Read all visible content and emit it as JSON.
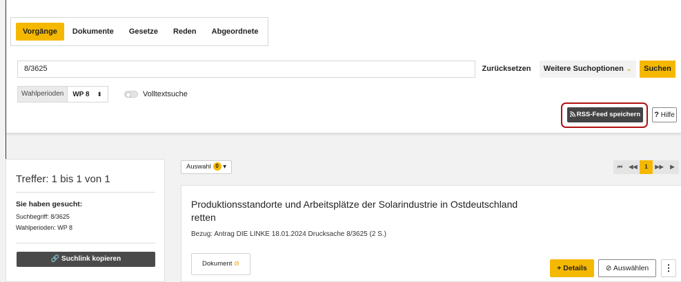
{
  "tabs": [
    {
      "label": "Vorgänge",
      "active": true
    },
    {
      "label": "Dokumente",
      "active": false
    },
    {
      "label": "Gesetze",
      "active": false
    },
    {
      "label": "Reden",
      "active": false
    },
    {
      "label": "Abgeordnete",
      "active": false
    }
  ],
  "search": {
    "value": "8/3625",
    "reset_label": "Zurücksetzen",
    "more_options_label": "Weitere Suchoptionen",
    "submit_label": "Suchen"
  },
  "filters": {
    "wahlperioden_label": "Wahlperioden",
    "wahlperioden_value": "WP 8",
    "volltext_label": "Volltextsuche",
    "volltext_on": false
  },
  "actions": {
    "rss_label": "RSS-Feed speichern",
    "help_label": "Hilfe"
  },
  "sidebar": {
    "hits": "Treffer: 1 bis 1 von 1",
    "searched_title": "Sie haben gesucht:",
    "searched_term": "Suchbegriff: 8/3625",
    "searched_periods": "Wahlperioden: WP 8",
    "copy_link_label": "Suchlink kopieren"
  },
  "results": {
    "auswahl_label": "Auswahl",
    "auswahl_count": "0",
    "pager": {
      "first": "⏮",
      "prev": "◀◀",
      "current": "1",
      "next": "▶▶",
      "last": "▶"
    },
    "items": [
      {
        "title": "Produktionsstandorte und Arbeitsplätze der Solarindustrie in Ostdeutschland retten",
        "reference": "Bezug: Antrag DIE LINKE 18.01.2024 Drucksache 8/3625 (2 S.)",
        "document_label": "Dokument",
        "details_label": "+ Details",
        "select_label": "Auswählen"
      }
    ]
  },
  "colors": {
    "accent": "#f5b800",
    "dark_button": "#444444",
    "highlight_border": "#b01010"
  },
  "icons": [
    "rss-icon",
    "help-icon",
    "link-icon",
    "paperclip-icon",
    "check-circle-icon",
    "kebab-icon",
    "chevron-down-icon"
  ]
}
